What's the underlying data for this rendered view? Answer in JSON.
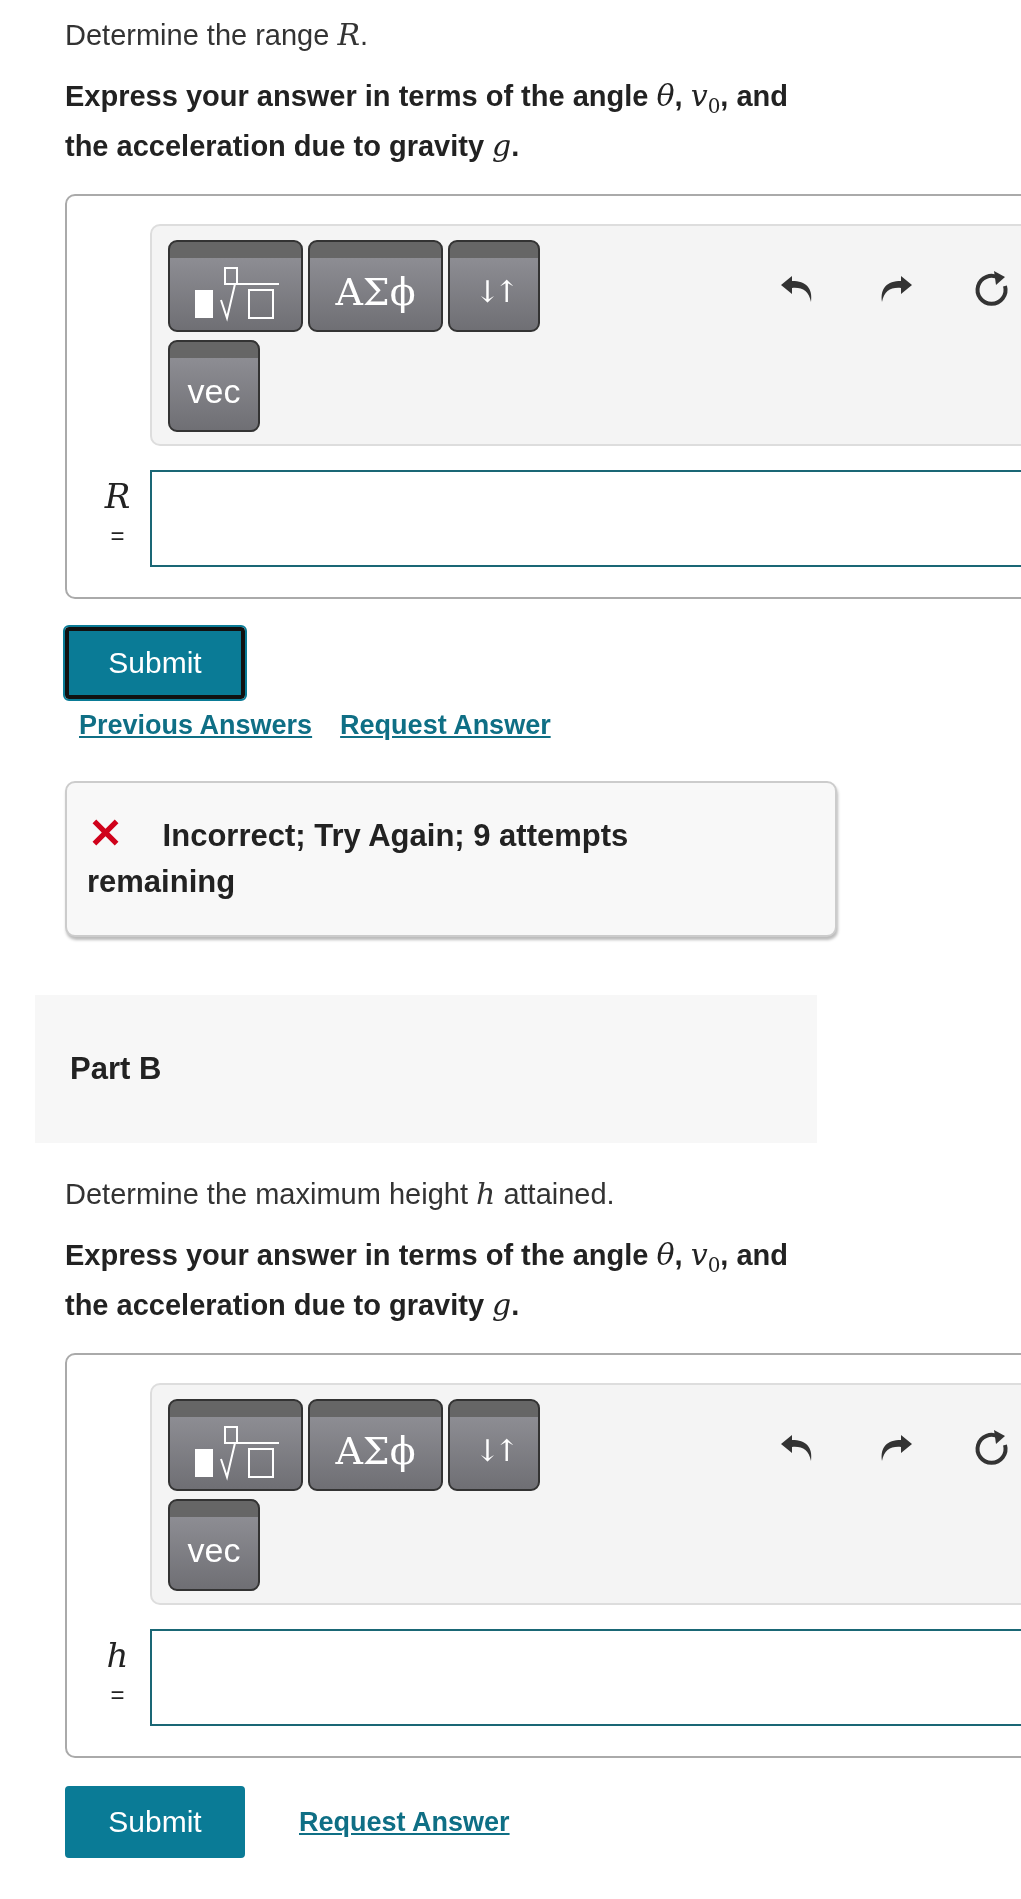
{
  "parts": [
    {
      "prompt": "Determine the range *R*.",
      "instruction": "Express your answer in terms of the angle *θ*, *v*$_{0}$, and the acceleration due to gravity *g*.",
      "toolbar": {
        "buttons": [
          {
            "kind": "templates"
          },
          {
            "kind": "symbols",
            "label": "ΑΣϕ"
          },
          {
            "kind": "arrows",
            "label": "↓↑"
          },
          {
            "kind": "vec",
            "label": "vec"
          }
        ],
        "tools": [
          {
            "kind": "undo"
          },
          {
            "kind": "redo"
          },
          {
            "kind": "reset"
          }
        ]
      },
      "variable": "R",
      "equals": "=",
      "submit": {
        "label": "Submit",
        "focused": true
      },
      "links": [
        "Previous Answers",
        "Request Answer"
      ],
      "feedback": {
        "kind": "incorrect",
        "text": "Incorrect; Try Again; 9 attempts remaining"
      }
    },
    {
      "heading": "Part B",
      "prompt": "Determine the maximum height *h* attained.",
      "instruction": "Express your answer in terms of the angle *θ*, *v*$_{0}$, and the acceleration due to gravity *g*.",
      "toolbar": {
        "buttons": [
          {
            "kind": "templates"
          },
          {
            "kind": "symbols",
            "label": "ΑΣϕ"
          },
          {
            "kind": "arrows",
            "label": "↓↑"
          },
          {
            "kind": "vec",
            "label": "vec"
          }
        ],
        "tools": [
          {
            "kind": "undo"
          },
          {
            "kind": "redo"
          },
          {
            "kind": "reset"
          }
        ]
      },
      "variable": "h",
      "equals": "=",
      "submit": {
        "label": "Submit",
        "focused": false
      },
      "links": [
        "Request Answer"
      ]
    }
  ]
}
